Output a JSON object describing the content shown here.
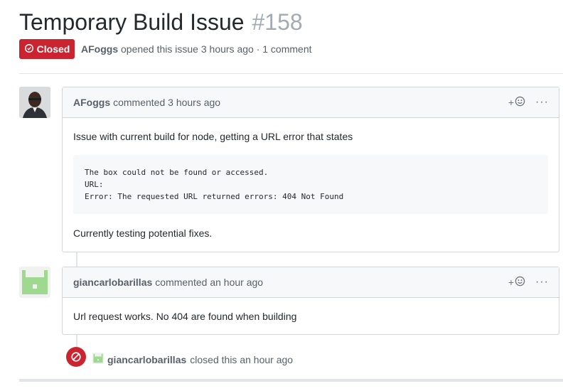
{
  "issue": {
    "title": "Temporary Build Issue",
    "number": "#158",
    "state_label": "Closed",
    "author": "AFoggs",
    "opened_text": "opened this issue 3 hours ago · 1 comment"
  },
  "comments": [
    {
      "author": "AFoggs",
      "meta": "commented 3 hours ago",
      "reaction_label": "+",
      "more_label": "···",
      "body_intro": "Issue with current build for node, getting a URL error that states",
      "code_lines": [
        "The box could not be found or accessed.",
        "URL:",
        "Error: The requested URL returned errors: 404 Not Found"
      ],
      "body_outro": "Currently testing potential fixes."
    },
    {
      "author": "giancarlobarillas",
      "meta": "commented an hour ago",
      "reaction_label": "+",
      "more_label": "···",
      "body": "Url request works. No 404 are found when building"
    }
  ],
  "event": {
    "actor": "giancarlobarillas",
    "text": "closed this an hour ago"
  },
  "colors": {
    "closed_red": "#cb2431",
    "header_bg": "#f6f8fa",
    "identicon_green": "#9fd98f"
  }
}
